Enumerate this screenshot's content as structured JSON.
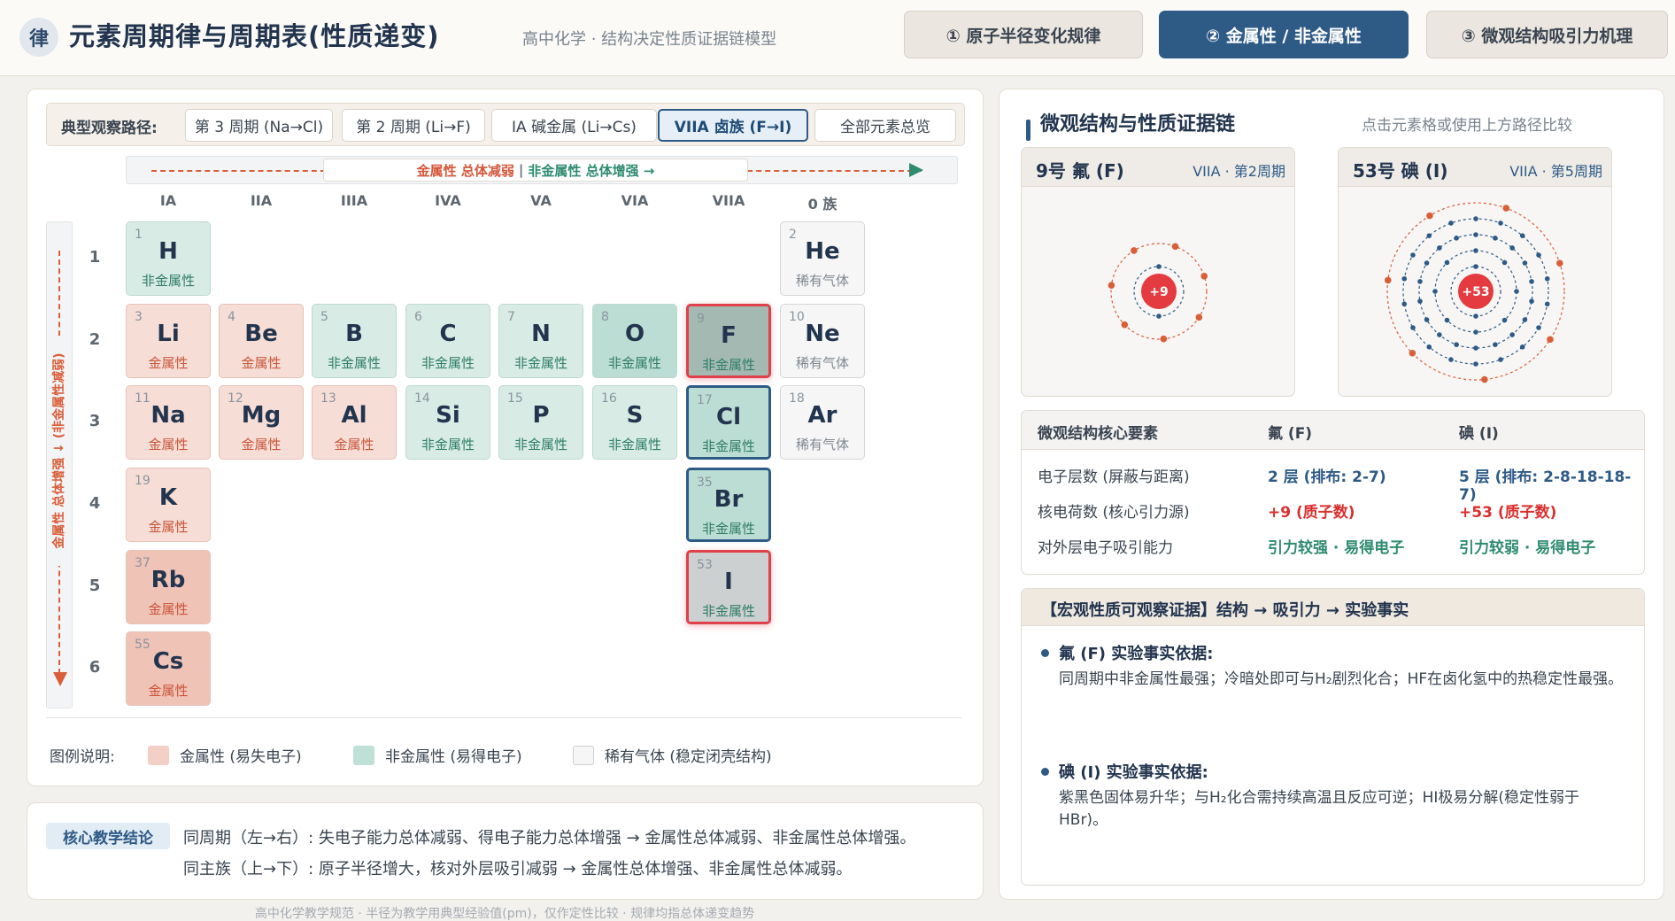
{
  "header": {
    "logo": "律",
    "title": "元素周期律与周期表(性质递变)",
    "subtitle": "高中化学 · 结构决定性质证据链模型",
    "nav": [
      "① 原子半径变化规律",
      "② 金属性 / 非金属性",
      "③ 微观结构吸引力机理"
    ]
  },
  "path": {
    "label": "典型观察路径:",
    "buttons": [
      "第 3 周期 (Na→Cl)",
      "第 2 周期 (Li→F)",
      "IA 碱金属 (Li→Cs)",
      "VIIA 卤族 (F→I)",
      "全部元素总览"
    ]
  },
  "trend": {
    "horizontal_metal": "金属性 总体减弱",
    "horizontal_sep": "|",
    "horizontal_nonmetal": "非金属性 总体增强 →",
    "vertical": "金属性 总体增强 ↓ (非金属性减弱)"
  },
  "groups": [
    "IA",
    "IIA",
    "IIIA",
    "IVA",
    "VA",
    "VIA",
    "VIIA",
    "0 族"
  ],
  "periods": [
    "1",
    "2",
    "3",
    "4",
    "5",
    "6"
  ],
  "elements": [
    {
      "num": "1",
      "sym": "H",
      "prop": "非金属性"
    },
    {
      "num": "2",
      "sym": "He",
      "prop": "稀有气体"
    },
    {
      "num": "3",
      "sym": "Li",
      "prop": "金属性"
    },
    {
      "num": "4",
      "sym": "Be",
      "prop": "金属性"
    },
    {
      "num": "5",
      "sym": "B",
      "prop": "非金属性"
    },
    {
      "num": "6",
      "sym": "C",
      "prop": "非金属性"
    },
    {
      "num": "7",
      "sym": "N",
      "prop": "非金属性"
    },
    {
      "num": "8",
      "sym": "O",
      "prop": "非金属性"
    },
    {
      "num": "9",
      "sym": "F",
      "prop": "非金属性"
    },
    {
      "num": "10",
      "sym": "Ne",
      "prop": "稀有气体"
    },
    {
      "num": "11",
      "sym": "Na",
      "prop": "金属性"
    },
    {
      "num": "12",
      "sym": "Mg",
      "prop": "金属性"
    },
    {
      "num": "13",
      "sym": "Al",
      "prop": "金属性"
    },
    {
      "num": "14",
      "sym": "Si",
      "prop": "非金属性"
    },
    {
      "num": "15",
      "sym": "P",
      "prop": "非金属性"
    },
    {
      "num": "16",
      "sym": "S",
      "prop": "非金属性"
    },
    {
      "num": "17",
      "sym": "Cl",
      "prop": "非金属性"
    },
    {
      "num": "18",
      "sym": "Ar",
      "prop": "稀有气体"
    },
    {
      "num": "19",
      "sym": "K",
      "prop": "金属性"
    },
    {
      "num": "35",
      "sym": "Br",
      "prop": "非金属性"
    },
    {
      "num": "37",
      "sym": "Rb",
      "prop": "金属性"
    },
    {
      "num": "53",
      "sym": "I",
      "prop": "非金属性"
    },
    {
      "num": "55",
      "sym": "Cs",
      "prop": "金属性"
    }
  ],
  "legend": {
    "label": "图例说明:",
    "metal": "金属性 (易失电子)",
    "nonmetal": "非金属性 (易得电子)",
    "noble": "稀有气体 (稳定闭壳结构)"
  },
  "conclusion": {
    "tag": "核心教学结论",
    "line1": "同周期（左→右）: 失电子能力总体减弱、得电子能力总体增强 → 金属性总体减弱、非金属性总体增强。",
    "line2": "同主族（上→下）: 原子半径增大，核对外层吸引减弱 → 金属性总体增强、非金属性总体减弱。"
  },
  "footnote": "高中化学教学规范 · 半径为教学用典型经验值(pm)，仅作定性比较 · 规律均指总体递变趋势",
  "right": {
    "title": "微观结构与性质证据链",
    "hint": "点击元素格或使用上方路径比较",
    "cards": [
      {
        "name": "9号 氟 (F)",
        "meta": "VIIA · 第2周期",
        "charge": "+9"
      },
      {
        "name": "53号 碘 (I)",
        "meta": "VIIA · 第5周期",
        "charge": "+53"
      }
    ],
    "table": {
      "headers": [
        "微观结构核心要素",
        "氟 (F)",
        "碘 (I)"
      ],
      "rows": [
        [
          "电子层数 (屏蔽与距离)",
          "2 层 (排布: 2-7)",
          "5 层 (排布: 2-8-18-18-7)"
        ],
        [
          "核电荷数 (核心引力源)",
          "+9 (质子数)",
          "+53 (质子数)"
        ],
        [
          "对外层电子吸引能力",
          "引力较强 · 易得电子",
          "引力较弱 · 易得电子"
        ]
      ]
    },
    "evidence": {
      "title": "【宏观性质可观察证据】结构 → 吸引力 → 实验事实",
      "f_label": "氟 (F) 实验事实依据:",
      "f_text": "同周期中非金属性最强；冷暗处即可与H₂剧烈化合；HF在卤化氢中的热稳定性最强。",
      "i_label": "碘 (I) 实验事实依据:",
      "i_text": "紫黑色固体易升华；与H₂化合需持续高温且反应可逆；HI极易分解(稳定性弱于HBr)。"
    }
  },
  "colors": {
    "accent": "#2e5a86",
    "metal": "#f6ddd6",
    "nonmetal": "#d8ebe5",
    "noble": "#f6f6f6",
    "selected_border": "#e0404a",
    "nucleus": "#e33b3f"
  }
}
